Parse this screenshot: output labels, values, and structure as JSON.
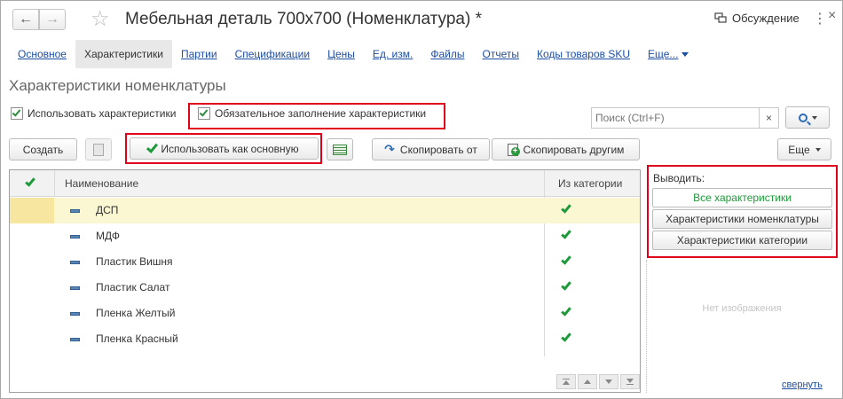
{
  "window": {
    "title": "Мебельная деталь 700x700 (Номенклатура) *",
    "discussion_label": "Обсуждение",
    "menu_dots": "⋮",
    "close_glyph": "×"
  },
  "tabs": [
    {
      "label": "Основное",
      "active": false
    },
    {
      "label": "Характеристики",
      "active": true
    },
    {
      "label": "Партии",
      "active": false
    },
    {
      "label": "Спецификации",
      "active": false
    },
    {
      "label": "Цены",
      "active": false
    },
    {
      "label": "Ед. изм.",
      "active": false
    },
    {
      "label": "Файлы",
      "active": false
    },
    {
      "label": "Отчеты",
      "active": false
    },
    {
      "label": "Коды товаров SKU",
      "active": false
    },
    {
      "label": "Еще...",
      "active": false
    }
  ],
  "section_title": "Характеристики номенклатуры",
  "options": {
    "use_characteristics": {
      "label": "Использовать характеристики",
      "checked": true
    },
    "required_fill": {
      "label": "Обязательное заполнение характеристики",
      "checked": true
    }
  },
  "search": {
    "placeholder": "Поиск (Ctrl+F)",
    "clear_glyph": "×"
  },
  "toolbar": {
    "create_label": "Создать",
    "use_as_main_label": "Использовать как основную",
    "copy_from_label": "Скопировать от",
    "copy_to_others_label": "Скопировать другим",
    "more_label": "Еще"
  },
  "table": {
    "columns": {
      "name": "Наименование",
      "from_category": "Из категории"
    },
    "rows": [
      {
        "name": "ДСП",
        "from_category": true,
        "selected": true
      },
      {
        "name": "МДФ",
        "from_category": true,
        "selected": false
      },
      {
        "name": "Пластик Вишня",
        "from_category": true,
        "selected": false
      },
      {
        "name": "Пластик Салат",
        "from_category": true,
        "selected": false
      },
      {
        "name": "Пленка Желтый",
        "from_category": true,
        "selected": false
      },
      {
        "name": "Пленка Красный",
        "from_category": true,
        "selected": false
      }
    ]
  },
  "output_panel": {
    "label": "Выводить:",
    "buttons": [
      {
        "label": "Все характеристики",
        "active": true
      },
      {
        "label": "Характеристики номенклатуры",
        "active": false
      },
      {
        "label": "Характеристики категории",
        "active": false
      }
    ]
  },
  "no_image_text": "Нет изображения",
  "collapse_label": "свернуть",
  "colors": {
    "accent_link": "#1c4ea3",
    "check_green": "#1e9a3a",
    "highlight_red": "#e0001b",
    "selected_row": "#fbf7d2"
  }
}
